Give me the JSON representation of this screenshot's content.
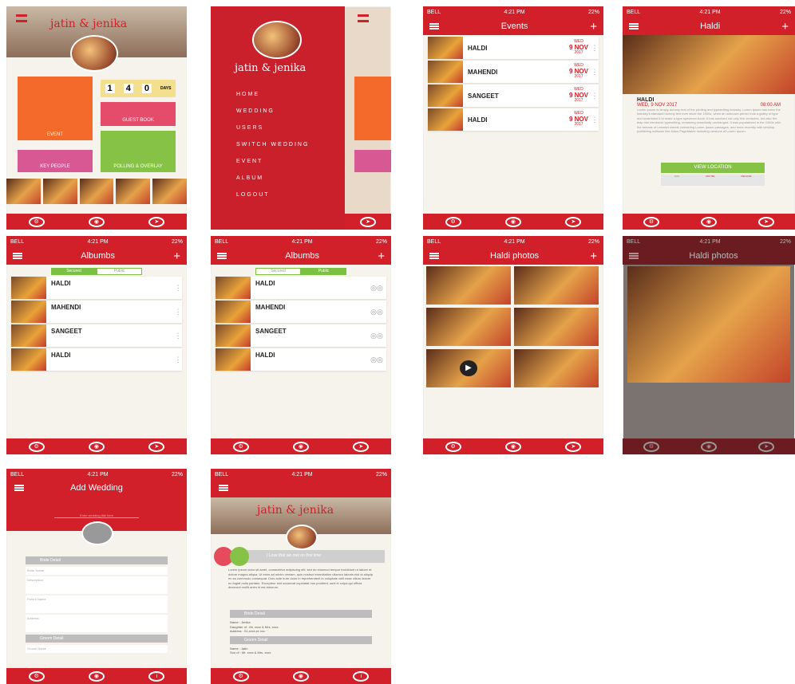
{
  "status": {
    "carrier": "BELL",
    "time": "4:21 PM",
    "battery": "22%"
  },
  "home": {
    "couple": "jatin & jenika",
    "days": [
      "1",
      "4",
      "0"
    ],
    "days_label": "DAYS",
    "tiles": {
      "event": "EVENT",
      "guest": "GUEST BOOK",
      "key": "KEY PEOPLE",
      "polling": "POLLING & OVERLAY"
    }
  },
  "menu": {
    "couple": "jatin & jenika",
    "items": [
      "HOME",
      "WEDDING",
      "USERS",
      "SWITCH WEDDING",
      "EVENT",
      "ALBUM",
      "LOGOUT"
    ]
  },
  "events": {
    "title": "Events",
    "items": [
      {
        "name": "HALDI",
        "wed": "WED",
        "day": "9 NOV",
        "year": "2017"
      },
      {
        "name": "MAHENDI",
        "wed": "WED",
        "day": "9 NOV",
        "year": "2017"
      },
      {
        "name": "SANGEET",
        "wed": "WED",
        "day": "9 NOV",
        "year": "2017"
      },
      {
        "name": "HALDI",
        "wed": "WED",
        "day": "9 NOV",
        "year": "2017"
      }
    ]
  },
  "haldi": {
    "title": "Haldi",
    "name": "HALDI",
    "date": "WED, 9 NOV 2017",
    "time": "08:00 AM",
    "body": "Lorem Ipsum is simply dummy text of the printing and typesetting industry. Lorem Ipsum has been the industry's standard dummy text ever since the 1500s, when an unknown printer took a galley of type and scrambled it to make a type specimen book. It has survived not only five centuries, but also the leap into electronic typesetting, remaining essentially unchanged. It was popularised in the 1960s with the release of Letraset sheets containing Lorem Ipsum passages, and more recently with desktop publishing software like Aldus PageMaker including versions of Lorem Ipsum.",
    "view": "VIEW LOCATION",
    "rsvp": [
      "JOIN",
      "MAY BE",
      "DECLINE"
    ]
  },
  "albums": {
    "title": "Albumbs",
    "seg": [
      "Secured",
      "Public"
    ],
    "items": [
      "HALDI",
      "MAHENDI",
      "SANGEET",
      "HALDI"
    ]
  },
  "photos": {
    "title": "Haldi photos"
  },
  "addwed": {
    "title": "Add Wedding",
    "hint": "Enter wedding title here",
    "bride": "Bride Detail",
    "groom": "Groom Detail",
    "f": [
      "Bride Name",
      "Description",
      "Parent Name",
      "Address",
      "Groom Name"
    ]
  },
  "detail": {
    "couple": "jatin & jenika",
    "tagline": "I Love that we met on first time",
    "text": "Lorem ipsum dolor sit amet, consectetur adipiscing elit, sed do eiusmod tempor incididunt ut labore et dolore magna aliqua. Ut enim ad minim veniam, quis nostrud exercitation ullamco laboris nisi ut aliquip ex ea commodo consequat. Duis aute irure dolor in reprehenderit in voluptate velit esse cillum dolore eu fugiat nulla pariatur. Excepteur sint occaecat cupidatat non proident, sunt in culpa qui officia deserunt mollit anim id est laborum.",
    "bride": "Bride Detail",
    "bname": "Name : Jenika",
    "bparent": "Daughter of : Mr. xxxx & Mrs. xxxx",
    "baddr": "Address : 01,xxxx,xx xxx",
    "groom": "Groom Detail",
    "gname": "Name : Jatin",
    "gparent": "Son of : Mr. xxxx & Mrs. xxxx"
  }
}
